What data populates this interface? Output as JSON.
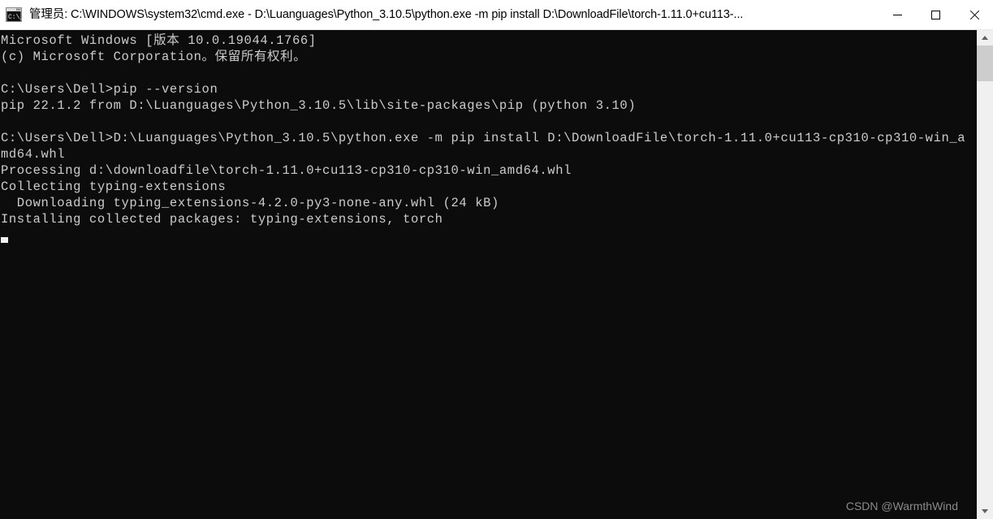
{
  "window": {
    "title": "管理员: C:\\WINDOWS\\system32\\cmd.exe - D:\\Luanguages\\Python_3.10.5\\python.exe  -m pip install D:\\DownloadFile\\torch-1.11.0+cu113-...",
    "icon": "cmd-console-icon",
    "controls": {
      "minimize_label": "最小化",
      "maximize_label": "最大化",
      "close_label": "关闭"
    },
    "colors": {
      "titlebar_bg": "#ffffff",
      "titlebar_fg": "#000000",
      "console_bg": "#0c0c0c",
      "console_fg": "#cccccc",
      "scrollbar_track": "#f0f0f0",
      "scrollbar_thumb": "#cdcdcd",
      "close_hover": "#e81123",
      "watermark_fg": "#8a8a8a"
    }
  },
  "console": {
    "lines": [
      "Microsoft Windows [版本 10.0.19044.1766]",
      "(c) Microsoft Corporation。保留所有权利。",
      "",
      "C:\\Users\\Dell>pip --version",
      "pip 22.1.2 from D:\\Luanguages\\Python_3.10.5\\lib\\site-packages\\pip (python 3.10)",
      "",
      "C:\\Users\\Dell>D:\\Luanguages\\Python_3.10.5\\python.exe -m pip install D:\\DownloadFile\\torch-1.11.0+cu113-cp310-cp310-win_a",
      "md64.whl",
      "Processing d:\\downloadfile\\torch-1.11.0+cu113-cp310-cp310-win_amd64.whl",
      "Collecting typing-extensions",
      "  Downloading typing_extensions-4.2.0-py3-none-any.whl (24 kB)",
      "Installing collected packages: typing-extensions, torch"
    ],
    "cursor": "block-cursor"
  },
  "watermark": {
    "text": "CSDN @WarmthWind"
  },
  "scrollbar": {
    "up_arrow": "chevron-up-icon",
    "down_arrow": "chevron-down-icon",
    "thumb": "scrollbar-thumb"
  }
}
